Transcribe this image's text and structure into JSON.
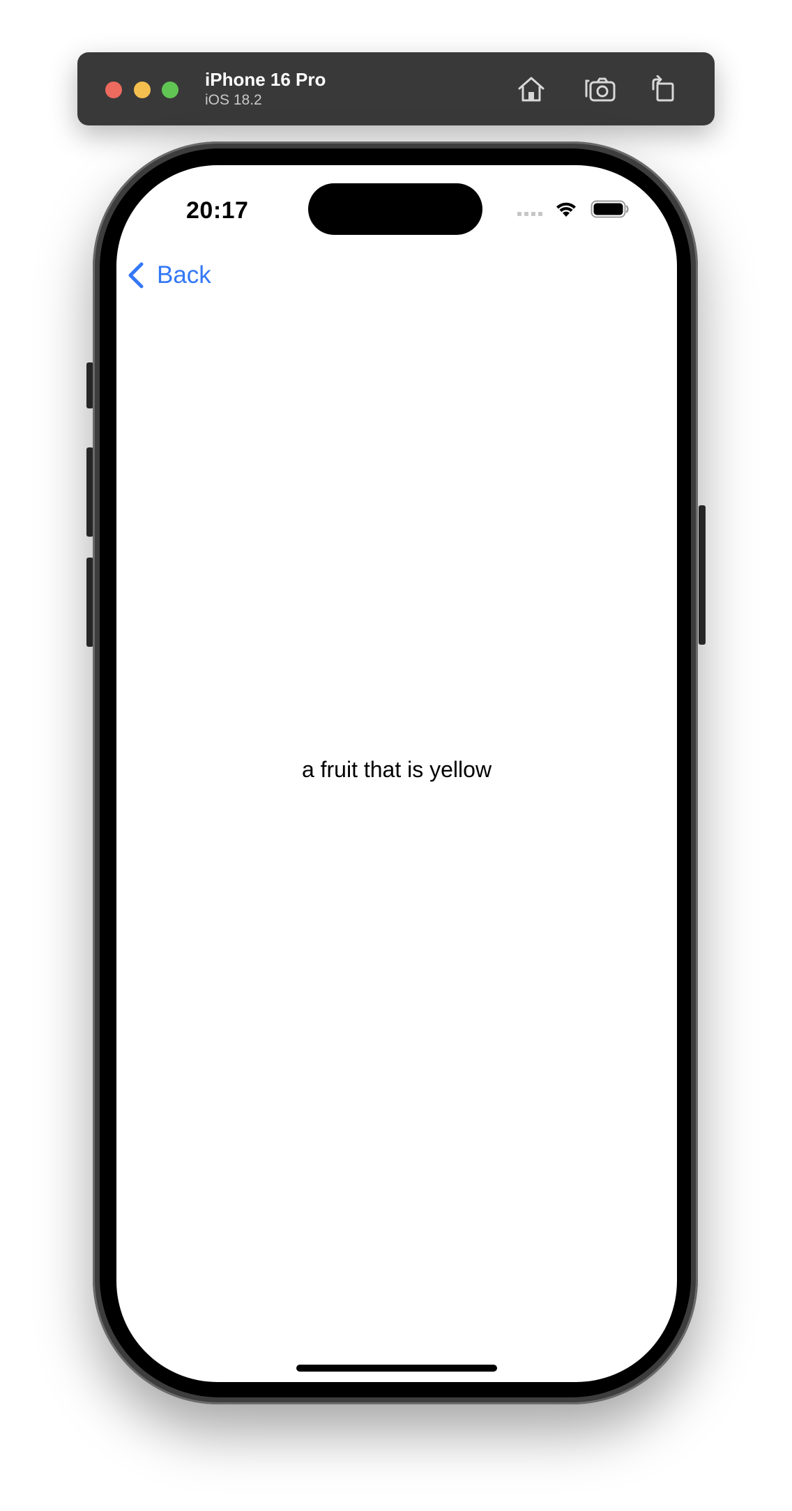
{
  "simulator": {
    "device_name": "iPhone 16 Pro",
    "os_version": "iOS 18.2",
    "icons": [
      "home-icon",
      "screenshot-icon",
      "rotate-icon"
    ]
  },
  "status_bar": {
    "time": "20:17",
    "icons": [
      "signal-icon",
      "wifi-icon",
      "battery-icon"
    ]
  },
  "nav": {
    "back_label": "Back",
    "back_icon": "chevron-left-icon",
    "accent_color": "#3478f6"
  },
  "content": {
    "text": "a fruit that is yellow"
  }
}
